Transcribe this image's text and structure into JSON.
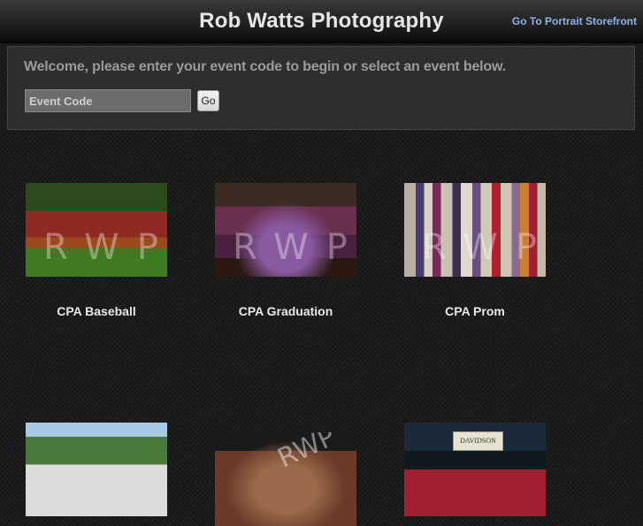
{
  "header": {
    "title": "Rob Watts Photography",
    "storefront_link": "Go To Portrait Storefront"
  },
  "welcome": {
    "message": "Welcome, please enter your event code to begin or select an event below.",
    "event_code_placeholder": "Event Code",
    "event_code_value": "",
    "go_label": "Go"
  },
  "events": [
    {
      "label": "CPA Baseball",
      "watermark": "RWP"
    },
    {
      "label": "CPA Graduation",
      "watermark": "RWP"
    },
    {
      "label": "CPA Prom",
      "watermark": "RWP"
    },
    {
      "label": "",
      "watermark": ""
    },
    {
      "label": "",
      "watermark": "RWP"
    },
    {
      "label": "",
      "watermark": "",
      "banner_text": "DAVIDSON"
    }
  ],
  "colors": {
    "link": "#8fb3e8",
    "panel": "#2e2e2e",
    "background": "#1b1b1b"
  }
}
